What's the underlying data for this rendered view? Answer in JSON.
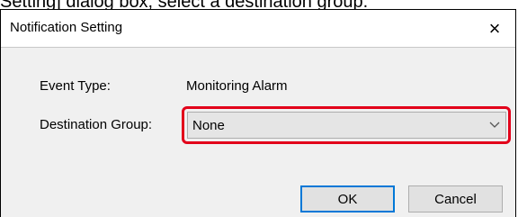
{
  "caption": "Setting] dialog box, select a destination group.",
  "dialog": {
    "title": "Notification Setting",
    "close_glyph": "×",
    "event_type_label": "Event Type:",
    "event_type_value": "Monitoring Alarm",
    "destination_group_label": "Destination Group:",
    "destination_group_value": "None",
    "ok_label": "OK",
    "cancel_label": "Cancel"
  },
  "icons": {
    "close": "close-icon",
    "dropdown": "chevron-down-icon"
  },
  "colors": {
    "highlight": "#e2001a",
    "focus_border": "#0078d7",
    "dialog_bg": "#f0f0f0"
  }
}
